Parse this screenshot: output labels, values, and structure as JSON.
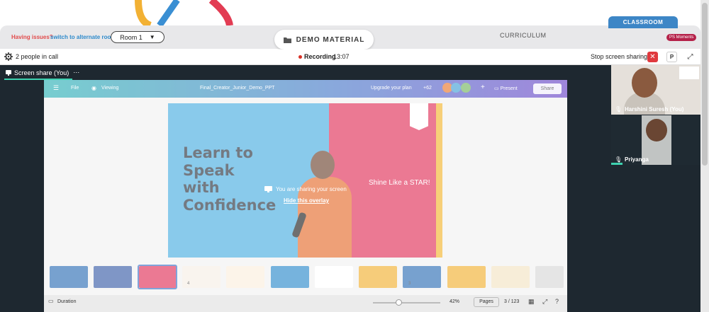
{
  "room_bar": {
    "issues_text": "Having issues?",
    "alternate_link": "switch to alternate room",
    "room_select": "Room 1",
    "demo_tab": "DEMO MATERIAL",
    "curriculum_tab": "CURRICULUM",
    "classroom_tab": "CLASSROOM",
    "moments_badge": "PS Moments"
  },
  "call_header": {
    "people_count": "2 people in call",
    "recording_label": "Recording",
    "recording_time": "13:07",
    "stop_sharing": "Stop screen sharing",
    "pin_label": "P"
  },
  "stage": {
    "share_tab": "Screen share (You)",
    "overlay_message": "You are sharing your screen",
    "overlay_hide": "Hide this overlay"
  },
  "shared_app": {
    "file_menu": "File",
    "viewing_menu": "Viewing",
    "doc_title": "Final_Creator_Junior_Demo_PPT",
    "upgrade": "Upgrade your plan",
    "collab_count": "+62",
    "present": "Present",
    "share": "Share",
    "slide": {
      "title": "Learn to\nSpeak\nwith\nConfidence",
      "tagline": "Shine Like a STAR!"
    },
    "thumb_numbers": [
      "4",
      "3"
    ],
    "duration": "Duration",
    "zoom": "42%",
    "pages_button": "Pages",
    "page_indicator": "3 / 123"
  },
  "participants": [
    {
      "name": "Harshini Suresh (You)"
    },
    {
      "name": "Priyanga"
    }
  ],
  "colors": {
    "classroom_blue": "#3d86c6",
    "recording_red": "#d93025",
    "accent_teal": "#3ed1b0",
    "stop_red": "#e0393e"
  }
}
